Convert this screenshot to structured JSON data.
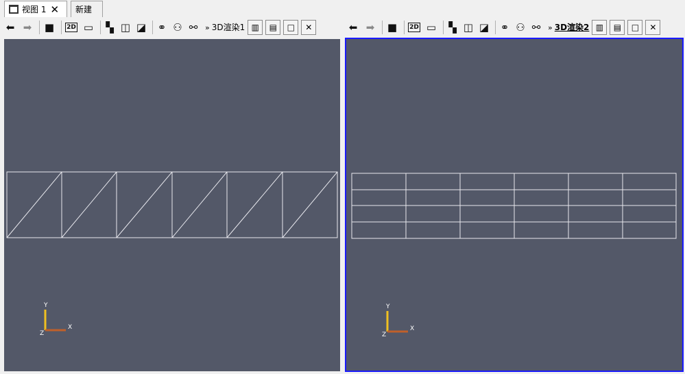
{
  "tabs": [
    {
      "label": "视图 1",
      "close": "✕",
      "active": true
    },
    {
      "label": "新建",
      "active": false
    }
  ],
  "toolbars": [
    {
      "view_label": "3D渲染1",
      "chevron": "»",
      "active": false
    },
    {
      "view_label": "3D渲染2",
      "chevron": "»",
      "active": true
    }
  ],
  "toolbar_icons": [
    "camera-undo-icon",
    "camera-redo-icon",
    "screenshot-icon",
    "2d-3d-toggle-icon",
    "record-icon",
    "select-cells-icon",
    "select-points-icon",
    "select-block-icon",
    "interactive-select-icon",
    "select-frustum-icon",
    "pick-icon"
  ],
  "frame_buttons": [
    "split-horizontal-icon",
    "split-vertical-icon",
    "maximize-icon",
    "close-icon"
  ],
  "axes": {
    "y": "Y",
    "x": "X",
    "z": "Z"
  },
  "colors": {
    "viewport": "#535868",
    "active_border": "#1a1aff",
    "mesh": "#e8e8ee",
    "axis_y": "#f0c020",
    "axis_x": "#c0602a"
  }
}
